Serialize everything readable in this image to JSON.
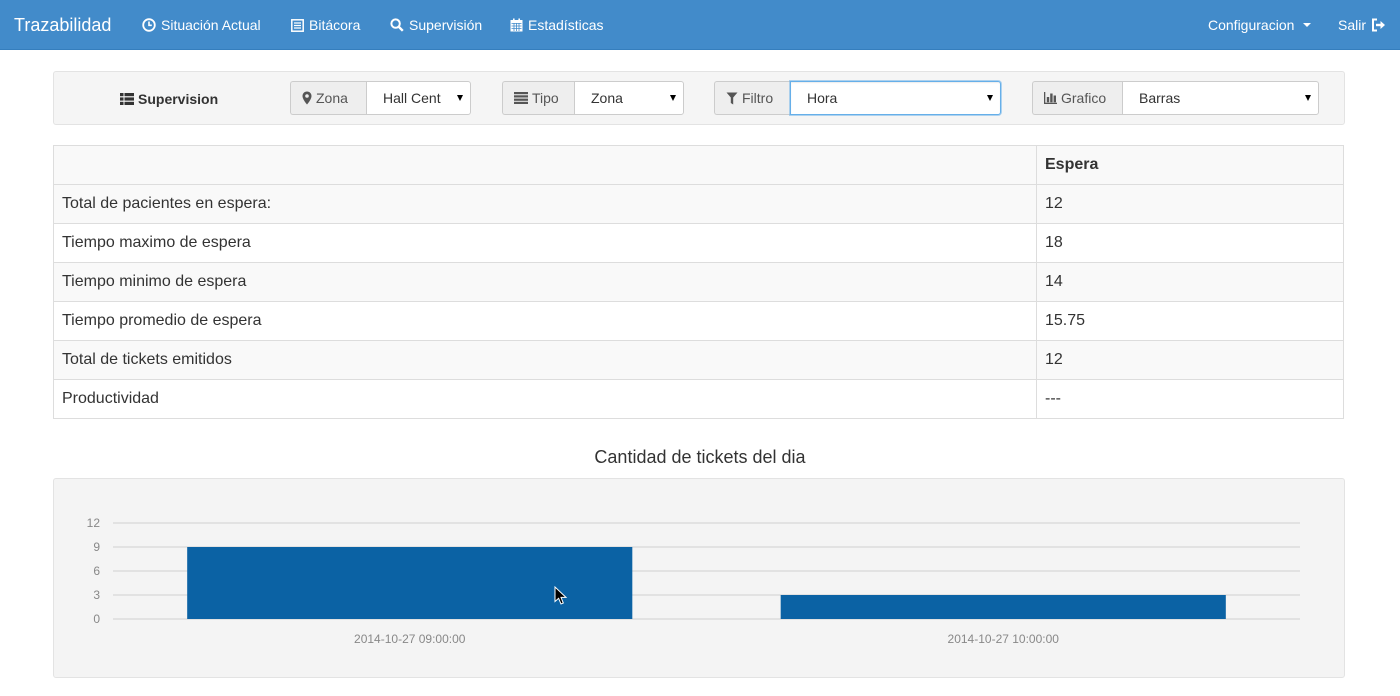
{
  "navbar": {
    "brand": "Trazabilidad",
    "items": [
      {
        "label": "Situación Actual",
        "icon": "clock-icon"
      },
      {
        "label": "Bitácora",
        "icon": "list-alt-icon"
      },
      {
        "label": "Supervisión",
        "icon": "search-icon"
      },
      {
        "label": "Estadísticas",
        "icon": "calendar-icon"
      }
    ],
    "config_label": "Configuracion",
    "logout_label": "Salir",
    "bg_color": "#428bca"
  },
  "toolbar": {
    "title": "Supervision",
    "zona": {
      "label": "Zona",
      "value": "Hall Cent"
    },
    "tipo": {
      "label": "Tipo",
      "value": "Zona"
    },
    "filtro": {
      "label": "Filtro",
      "value": "Hora"
    },
    "grafico": {
      "label": "Grafico",
      "value": "Barras"
    }
  },
  "table": {
    "header": [
      "",
      "Espera"
    ],
    "rows": [
      {
        "label": "Total de pacientes en espera:",
        "value": "12"
      },
      {
        "label": "Tiempo maximo de espera",
        "value": "18"
      },
      {
        "label": "Tiempo minimo de espera",
        "value": "14"
      },
      {
        "label": "Tiempo promedio de espera",
        "value": "15.75"
      },
      {
        "label": "Total de tickets emitidos",
        "value": "12"
      },
      {
        "label": "Productividad",
        "value": "---"
      }
    ]
  },
  "chart_data": {
    "type": "bar",
    "title": "Cantidad de tickets del dia",
    "categories": [
      "2014-10-27 09:00:00",
      "2014-10-27 10:00:00"
    ],
    "values": [
      9,
      3
    ],
    "ylim": [
      0,
      12
    ],
    "yticks": [
      0,
      3,
      6,
      9,
      12
    ],
    "grid": true,
    "bar_color": "#0b62a4"
  }
}
